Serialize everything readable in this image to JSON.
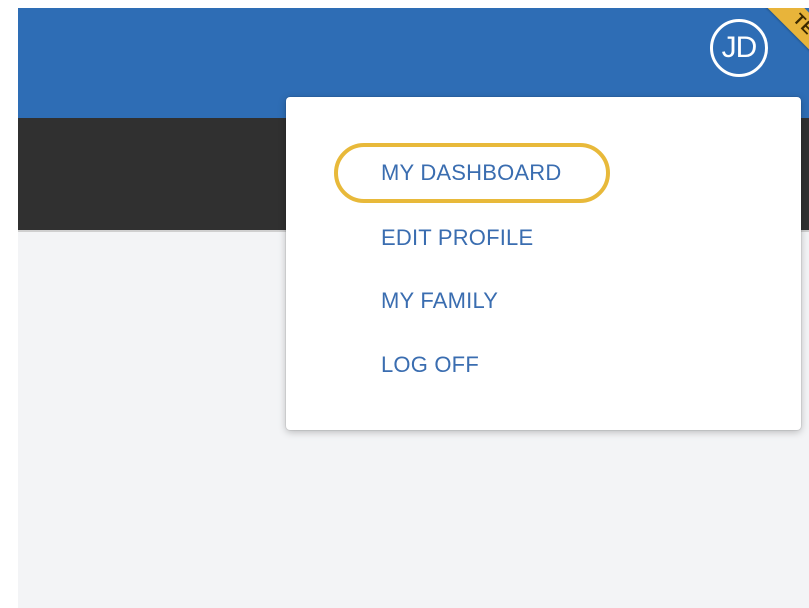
{
  "header": {
    "avatar_initials": "JD",
    "env_badge": "TEST"
  },
  "user_menu": {
    "items": [
      {
        "label": "MY DASHBOARD",
        "highlighted": true
      },
      {
        "label": "EDIT PROFILE"
      },
      {
        "label": "MY FAMILY"
      },
      {
        "label": "LOG OFF"
      }
    ]
  },
  "colors": {
    "header": "#2e6db5",
    "subnav": "#303030",
    "page_background": "#f3f4f6",
    "menu_text": "#3a6db0",
    "highlight": "#e8b93a",
    "badge": "#e8b43a"
  }
}
